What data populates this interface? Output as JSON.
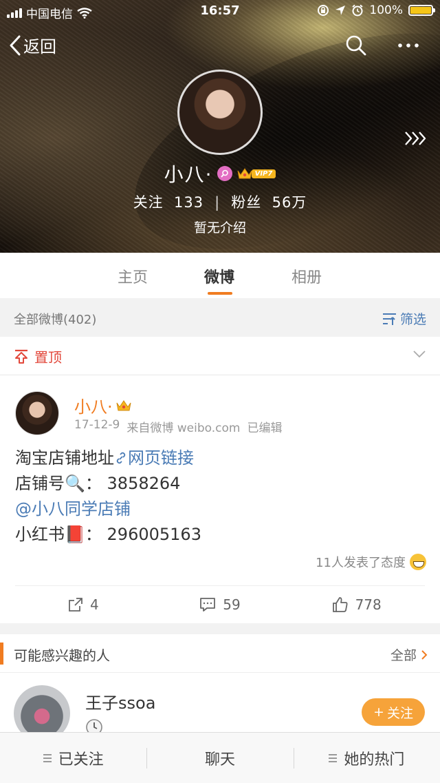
{
  "status_bar": {
    "carrier": "中国电信",
    "time": "16:57",
    "battery": "100%",
    "battery_level": 1.0
  },
  "nav": {
    "back_label": "返回"
  },
  "profile": {
    "name": "小八·",
    "vip_label": "VIP7",
    "following_label": "关注",
    "following_count": "133",
    "followers_label": "粉丝",
    "followers_count": "56万",
    "bio": "暂无介绍"
  },
  "tabs": [
    {
      "label": "主页"
    },
    {
      "label": "微博",
      "active": true
    },
    {
      "label": "相册"
    }
  ],
  "filter": {
    "count_label": "全部微博(402)",
    "filter_label": "筛选"
  },
  "pinned": {
    "label": "置顶"
  },
  "post": {
    "author": "小八·",
    "date": "17-12-9",
    "source": "来自微博 weibo.com",
    "edited": "已编辑",
    "line1_text": "淘宝店铺地址",
    "line1_link": "网页链接",
    "line2_text": "店铺号🔍：",
    "line2_value": "3858264",
    "line3_link": "@小八同学店铺",
    "line4_text": "小红书📕：",
    "line4_value": "296005163",
    "reactions": "11人发表了态度",
    "reposts": "4",
    "comments": "59",
    "likes": "778"
  },
  "suggestions": {
    "title": "可能感兴趣的人",
    "all_label": "全部",
    "items": [
      {
        "name": "王子ssoa",
        "follow_label": "关注"
      }
    ]
  },
  "bottom_bar": {
    "followed": "已关注",
    "chat": "聊天",
    "hot": "她的热门"
  },
  "colors": {
    "accent": "#f07c21",
    "link": "#4a7bb5",
    "pin": "#e2483b",
    "vip": "#f6b61f"
  }
}
